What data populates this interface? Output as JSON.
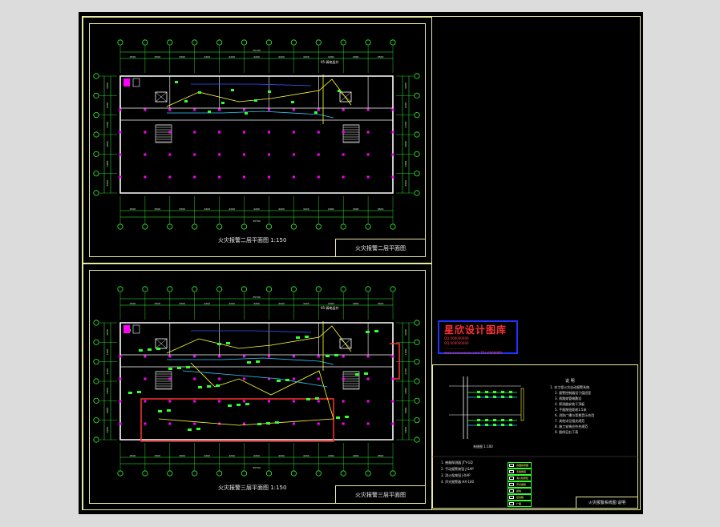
{
  "sheet": {
    "upper_plan": {
      "caption": "火灾报警二层平面图 1:150",
      "title": "火灾报警二层平面图",
      "top_dims": [
        "2500",
        "2500",
        "2500",
        "4200",
        "4200",
        "4200",
        "4200",
        "4200",
        "2900",
        "2900",
        "2500"
      ],
      "bottom_dims": [
        "2500",
        "2500",
        "2500",
        "4200",
        "4200",
        "4200",
        "4200",
        "4200",
        "2900",
        "2900",
        "2500"
      ],
      "total_dim": "35700",
      "left_dims": [
        "3600",
        "1200",
        "2100",
        "1800",
        "3600",
        "3600"
      ],
      "right_dims": [
        "3600",
        "1200",
        "2100",
        "1800",
        "3600",
        "3600"
      ],
      "label": "05-弱电竖井"
    },
    "lower_plan": {
      "caption": "火灾报警三层平面图 1:150",
      "title": "火灾报警三层平面图",
      "top_dims": [
        "2500",
        "2500",
        "2500",
        "4200",
        "4200",
        "4200",
        "4200",
        "4200",
        "2900",
        "2900",
        "2500"
      ],
      "bottom_dims": [
        "2500",
        "2500",
        "2500",
        "4200",
        "4200",
        "4200",
        "4200",
        "4200",
        "2900",
        "2900",
        "2500"
      ],
      "total_dim": "35700",
      "left_dims": [
        "3600",
        "1200",
        "2100",
        "1800",
        "3600",
        "3600"
      ],
      "right_dims": [
        "3600",
        "1200",
        "2100",
        "1800",
        "3600",
        "3600"
      ],
      "label": "05-弱电竖井"
    },
    "watermark": {
      "title": "星欣设计图库",
      "line1": "QQ:000000000",
      "line2": "QQ:000000000",
      "line3": "......................",
      "line4": "www.xxxxxxxxxx.com  TEL:0000000"
    },
    "legend_panel": {
      "heading": "说  明",
      "diagram_caption": "系统图 1:100",
      "notes": [
        "1. 本工程火灾自动报警系统",
        "2. 报警控制器设于值班室",
        "3. 线路穿管暗敷设",
        "4. 探测器安装于顶板",
        "5. 手报按钮距地1.5米",
        "6. 消防广播与背景音乐合用",
        "7. 其他详见相关规范",
        "8. 施工安装应符合规范",
        "9. 图例见右下表"
      ],
      "bottom_notes": [
        "1. 感烟探测器 JTY-GD",
        "2. 手动报警按钮 J-SAP",
        "3. 消火栓按钮 J-XAP",
        "4. 声光报警器 HX-100"
      ],
      "legend_table": [
        "感烟探测器",
        "手报按钮",
        "消火栓按钮",
        "声光报警",
        "模块",
        "接线箱",
        "广播"
      ],
      "title_block": "火灾报警系统图 说明"
    }
  },
  "colors": {
    "background": "#000000",
    "frame": "#e8e8a0",
    "wall": "#ffffff",
    "grid": "#33ff33",
    "magenta": "#ff00ff",
    "wire_yellow": "#ffff33",
    "wire_cyan": "#33ccff",
    "wire_blue": "#3355ff",
    "red": "#ff3333",
    "desktop": "#dcdcdc"
  }
}
